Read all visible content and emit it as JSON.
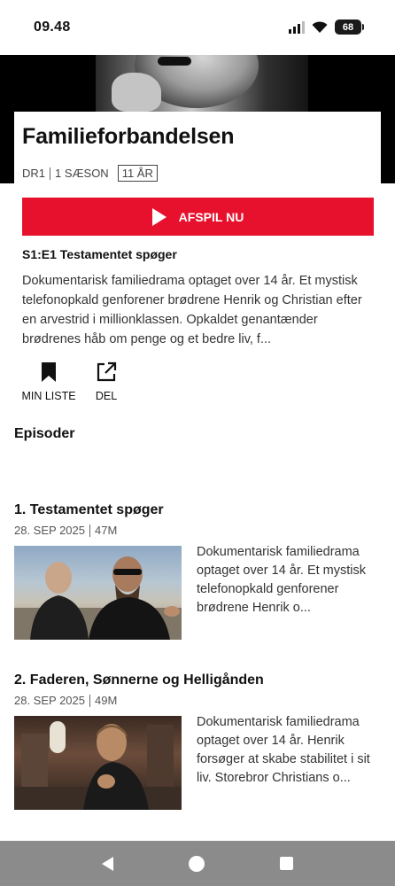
{
  "status_bar": {
    "time": "09.48",
    "battery": "68"
  },
  "show": {
    "title": "Familieforbandelsen",
    "channel": "DR1",
    "seasons": "1 SÆSON",
    "age_rating": "11 ÅR"
  },
  "play": {
    "label": "AFSPIL NU"
  },
  "current_episode": {
    "label": "S1:E1 Testamentet spøger",
    "description": "Dokumentarisk familiedrama optaget over 14 år. Et mystisk telefonopkald genforener brødrene Henrik og Christian efter en arvestrid i millionklassen. Opkaldet genantænder brødrenes håb om penge og et bedre liv, f..."
  },
  "actions": {
    "my_list": "MIN LISTE",
    "share": "DEL"
  },
  "episodes_section": {
    "heading": "Episoder",
    "items": [
      {
        "title": "1. Testamentet spøger",
        "date": "28. SEP 2025",
        "duration": "47M",
        "description": "Dokumentarisk familiedrama optaget over 14 år. Et mystisk telefonopkald genforener brødrene Henrik o..."
      },
      {
        "title": "2. Faderen, Sønnerne og Helligånden",
        "date": "28. SEP 2025",
        "duration": "49M",
        "description": "Dokumentarisk familiedrama optaget over 14 år. Henrik forsøger at skabe stabilitet i sit liv. Storebror Christians o..."
      }
    ]
  },
  "colors": {
    "accent": "#e8112d",
    "nav_bar": "#8a8b8a"
  },
  "icons": [
    "signal-icon",
    "wifi-icon",
    "battery-icon",
    "play-icon",
    "bookmark-icon",
    "share-icon",
    "back-icon",
    "home-icon",
    "recents-icon"
  ]
}
